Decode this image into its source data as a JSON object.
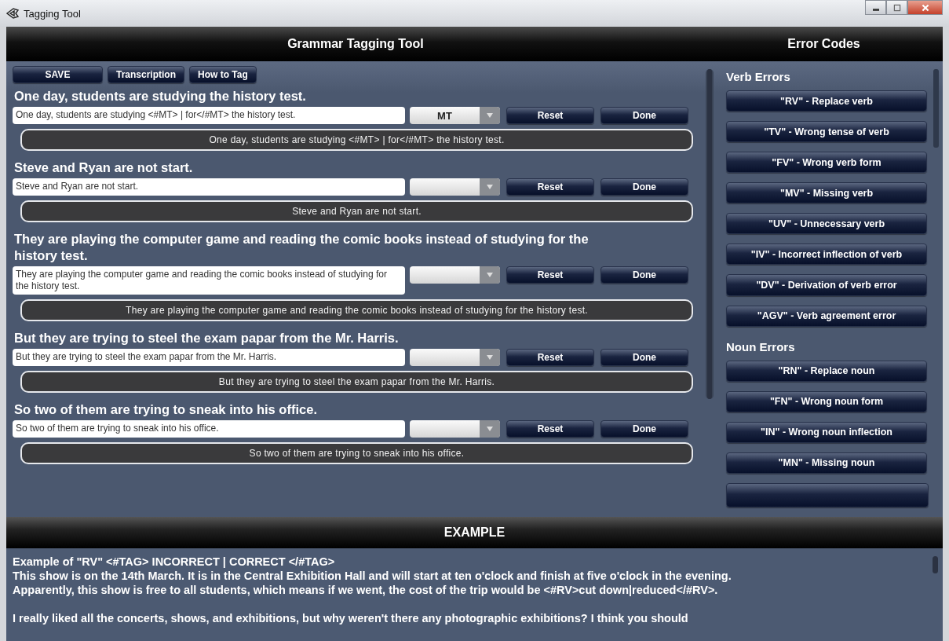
{
  "window": {
    "title": "Tagging Tool"
  },
  "header": {
    "title": "Grammar Tagging Tool",
    "side_title": "Error Codes"
  },
  "toolbar": [
    "SAVE",
    "Transcription",
    "How to Tag"
  ],
  "sentences": [
    {
      "heading": "One day, students are studying  the history test.",
      "input": "One day, students are studying <#MT> | for</#MT> the history test.",
      "tag": "MT",
      "reset": "Reset",
      "done": "Done",
      "output": "One day, students are studying <#MT> | for</#MT> the history test."
    },
    {
      "heading": "Steve and Ryan are not start.",
      "input": "Steve and Ryan are not start.",
      "reset": "Reset",
      "done": "Done",
      "output": "Steve and Ryan are not start."
    },
    {
      "heading": "They are playing the computer game and reading the comic books instead of studying for the history test.",
      "input": "They are playing the computer game and reading the comic books instead of studying for the history test.",
      "reset": "Reset",
      "done": "Done",
      "output": "They are playing the computer game and reading the comic books instead of studying for the history test."
    },
    {
      "heading": "But they are trying to steel the exam papar from the Mr. Harris.",
      "input": "But they are trying to steel the exam papar from the Mr. Harris.",
      "reset": "Reset",
      "done": "Done",
      "output": "But they are trying to steel the exam papar from the Mr. Harris."
    },
    {
      "heading": "So two of them are trying to sneak into his office.",
      "input": "So two of them are trying to sneak into his office.",
      "reset": "Reset",
      "done": "Done",
      "output": "So two of them are trying to sneak into his office."
    }
  ],
  "error_groups": [
    {
      "title": "Verb Errors",
      "codes": [
        "\"RV\" - Replace verb",
        "\"TV\" - Wrong tense of verb",
        "\"FV\" - Wrong verb form",
        "\"MV\" - Missing verb",
        "\"UV\" - Unnecessary verb",
        "\"IV\" - Incorrect inflection of verb",
        "\"DV\" - Derivation of verb error",
        "\"AGV\" - Verb agreement error"
      ]
    },
    {
      "title": "Noun Errors",
      "codes": [
        "\"RN\" - Replace noun",
        "\"FN\" - Wrong noun form",
        "\"IN\" - Wrong noun inflection",
        "\"MN\" - Missing noun"
      ]
    }
  ],
  "example": {
    "title": "EXAMPLE",
    "lines": [
      "Example of \"RV\"  <#TAG> INCORRECT | CORRECT </#TAG>",
      "This show is on the 14th March. It is in the Central Exhibition Hall and will start at ten o'clock and finish at five o'clock in the evening.",
      "Apparently, this show is free to all students, which means if we went, the cost of the trip would be <#RV>cut down|reduced</#RV>.",
      "I really liked all the concerts, shows, and exhibitions, but why weren't there any photographic exhibitions? I think you should"
    ]
  }
}
